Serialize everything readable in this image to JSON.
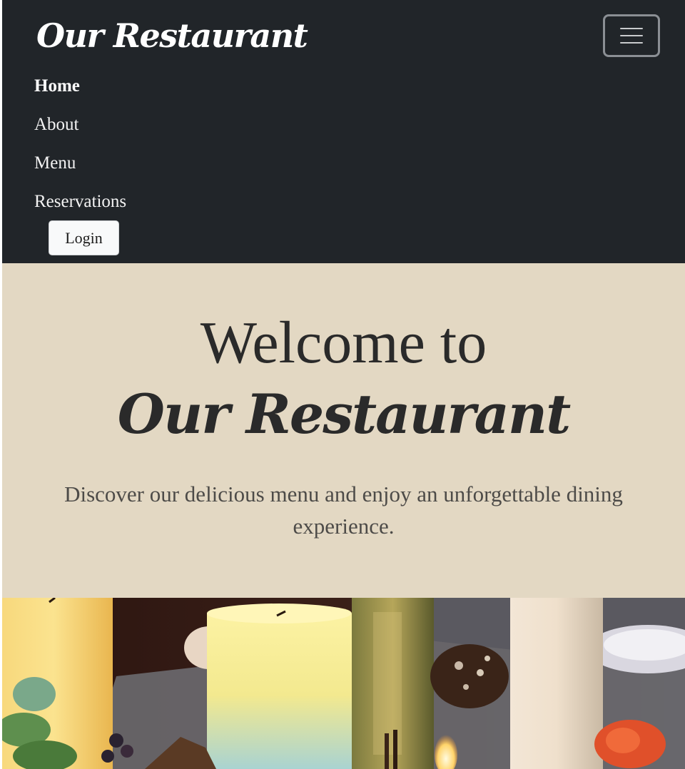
{
  "navbar": {
    "brand": "Our Restaurant",
    "toggler_icon": "hamburger-menu-icon",
    "links": [
      {
        "label": "Home",
        "active": true
      },
      {
        "label": "About",
        "active": false
      },
      {
        "label": "Menu",
        "active": false
      },
      {
        "label": "Reservations",
        "active": false
      }
    ],
    "login_label": "Login"
  },
  "hero": {
    "line1": "Welcome to",
    "line2": "Our Restaurant",
    "subtitle": "Discover our delicious menu and enjoy an unforgettable dining experience."
  },
  "photo": {
    "subject": "candles-table-photo"
  },
  "colors": {
    "navbar_bg": "#212529",
    "hero_bg": "#e3d8c3",
    "hero_text": "#2a2a2a",
    "login_bg": "#f8f9fa"
  }
}
